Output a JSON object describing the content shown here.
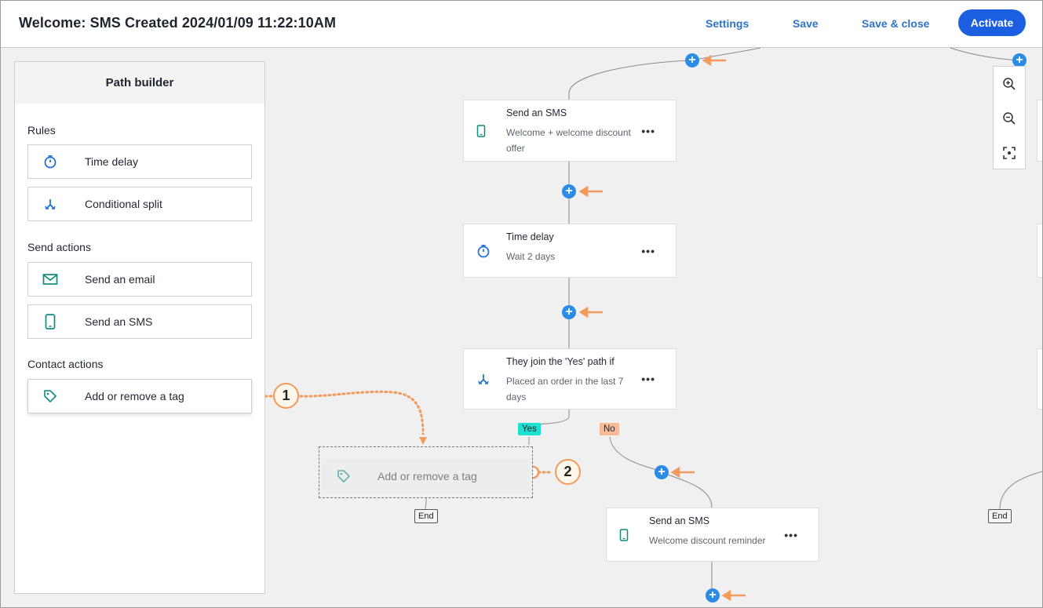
{
  "header": {
    "title": "Welcome: SMS Created 2024/01/09 11:22:10AM",
    "settings": "Settings",
    "save": "Save",
    "save_close": "Save & close",
    "activate": "Activate"
  },
  "sidebar": {
    "title": "Path builder",
    "sections": {
      "rules": "Rules",
      "send_actions": "Send actions",
      "contact_actions": "Contact actions"
    },
    "items": {
      "time_delay": "Time delay",
      "conditional_split": "Conditional split",
      "send_email": "Send an email",
      "send_sms": "Send an SMS",
      "add_remove_tag": "Add or remove a tag"
    }
  },
  "canvas": {
    "nodes": [
      {
        "title": "Send an SMS",
        "subtitle": "Welcome + welcome discount offer",
        "icon": "phone-icon"
      },
      {
        "title": "Time delay",
        "subtitle": "Wait 2 days",
        "icon": "timer-icon"
      },
      {
        "title": "They join the 'Yes' path if",
        "subtitle": "Placed an order in the last 7 days",
        "icon": "split-icon"
      },
      {
        "title": "Send an SMS",
        "subtitle": "Welcome discount reminder",
        "icon": "phone-icon"
      }
    ],
    "more_label": "•••",
    "plus_label": "+",
    "yes_label": "Yes",
    "no_label": "No",
    "end_label": "End",
    "ghost_label": "Add or remove a tag",
    "callouts": [
      "1",
      "2"
    ]
  },
  "colors": {
    "accent": "#1b5fe0",
    "link": "#2f74c7",
    "plus": "#2b8ce6",
    "arrow": "#f39a5c",
    "yes": "#1ee0d0",
    "no": "#f7b996"
  }
}
